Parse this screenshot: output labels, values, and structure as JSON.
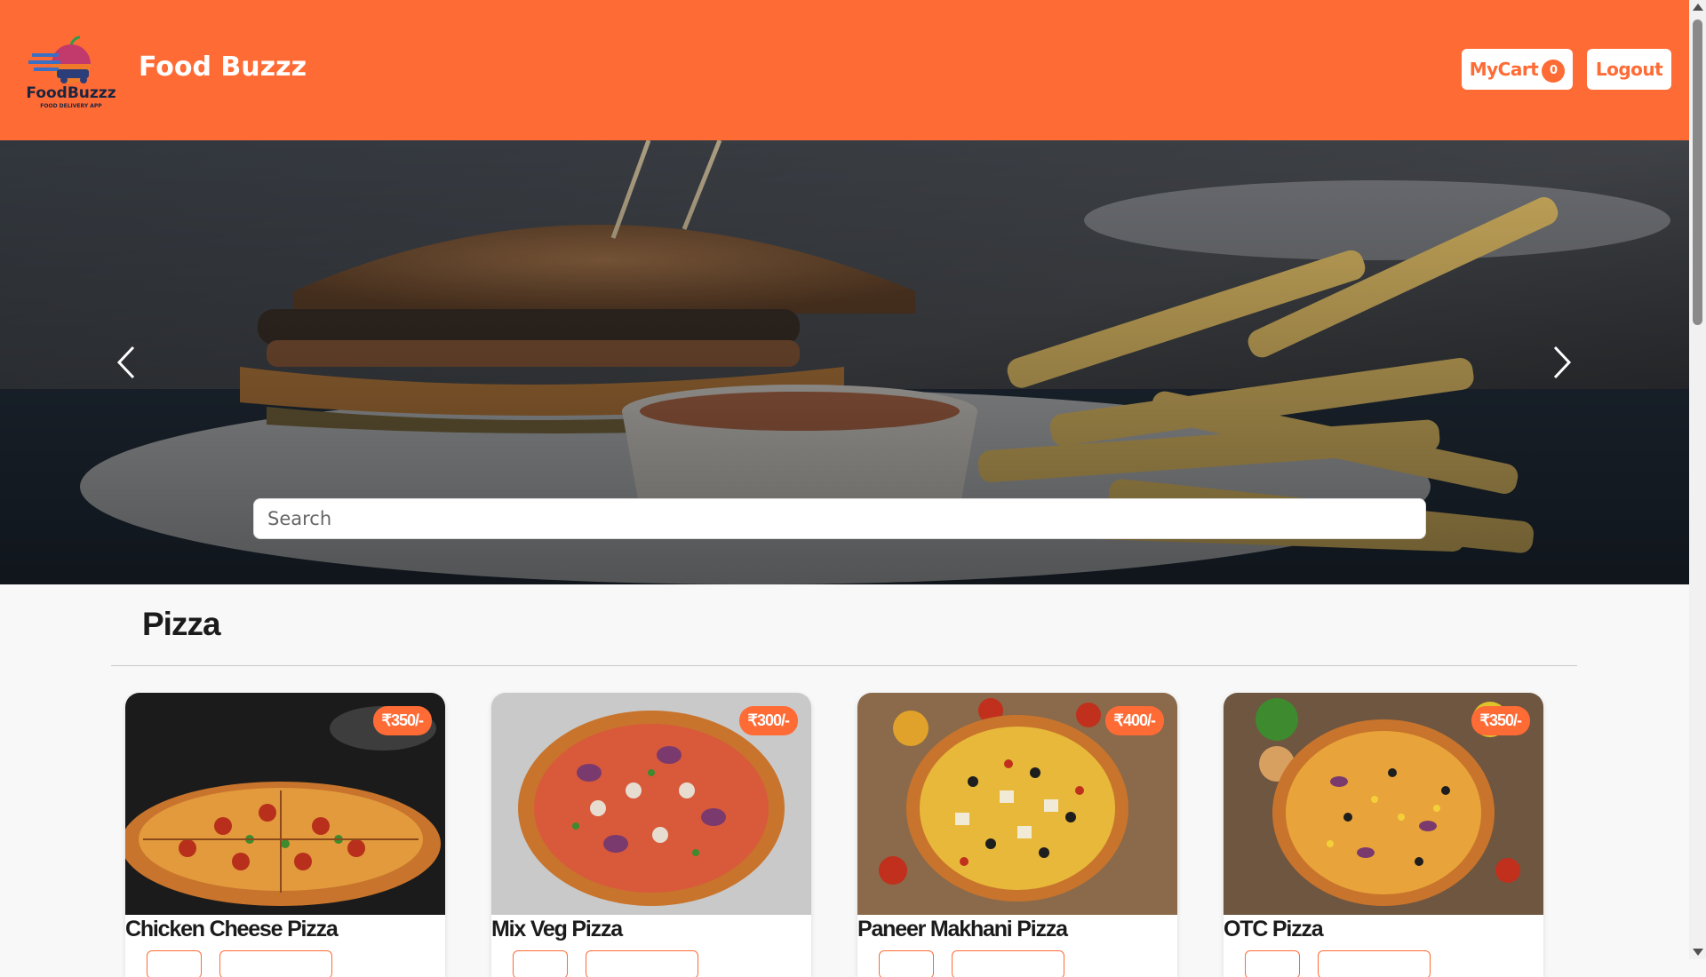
{
  "header": {
    "logo_text": "FoodBuzzz",
    "logo_tagline": "FOOD DELIVERY APP",
    "brand_name": "Food Buzzz",
    "cart_label": "MyCart",
    "cart_count": "0",
    "logout_label": "Logout"
  },
  "search": {
    "placeholder": "Search"
  },
  "category": {
    "title": "Pizza",
    "items": [
      {
        "name": "Chicken Cheese Pizza",
        "price": "₹350/-"
      },
      {
        "name": "Mix Veg Pizza",
        "price": "₹300/-"
      },
      {
        "name": "Paneer Makhani Pizza",
        "price": "₹400/-"
      },
      {
        "name": "OTC Pizza",
        "price": "₹350/-"
      }
    ]
  },
  "colors": {
    "accent": "#ff6b35",
    "background": "#f8f8f8"
  },
  "icons": [
    "chevron-left-icon",
    "chevron-right-icon"
  ]
}
